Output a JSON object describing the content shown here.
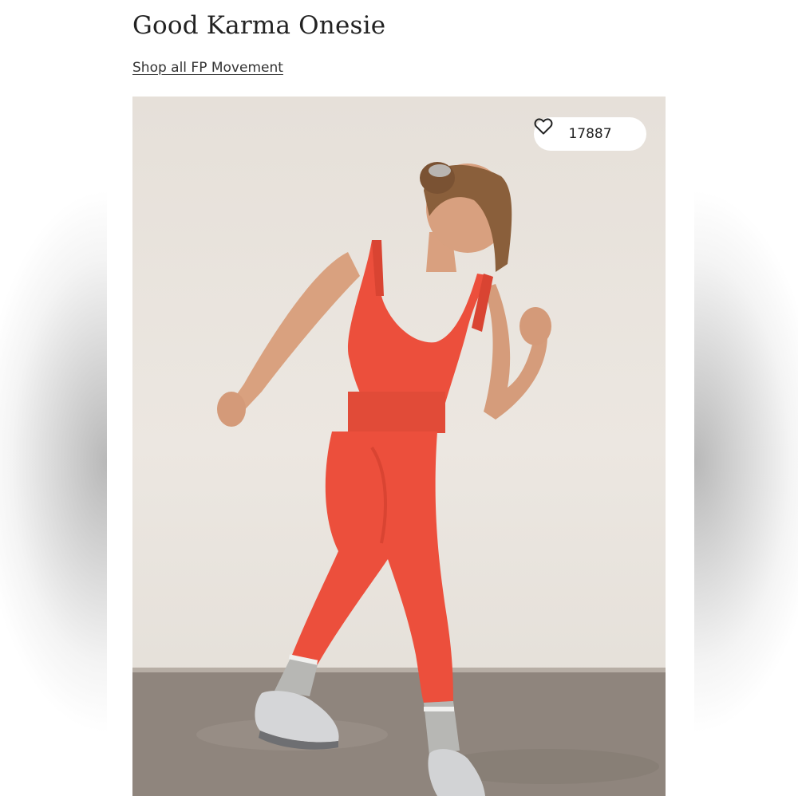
{
  "product": {
    "title": "Good Karma Onesie",
    "shop_link_label": "Shop all FP Movement"
  },
  "image": {
    "likes_count": "17887",
    "like_icon": "heart-outline-icon"
  },
  "colors": {
    "onesie": "#ec4f3c",
    "backdrop_wall": "#e8e3dd",
    "floor": "#8f857d"
  }
}
